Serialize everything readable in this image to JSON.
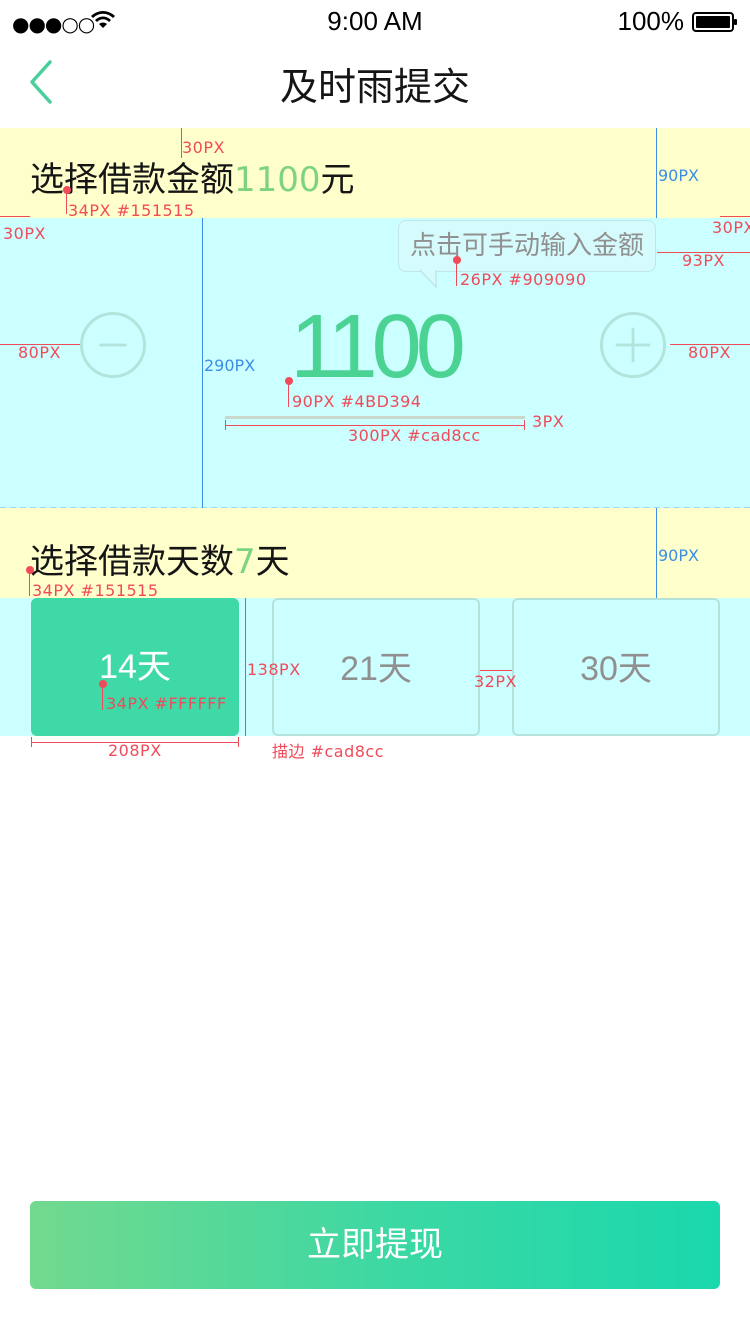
{
  "status_bar": {
    "signal": "●●●○○",
    "time": "9:00 AM",
    "battery": "100%"
  },
  "nav": {
    "title": "及时雨提交"
  },
  "amount_section": {
    "label_prefix": "选择借款金额",
    "label_amount": "1100",
    "label_suffix": "元",
    "value": "1100",
    "tooltip": "点击可手动输入金额"
  },
  "days_section": {
    "label_prefix": "选择借款天数",
    "label_days": "7",
    "label_suffix": "天",
    "options": [
      "14天",
      "21天",
      "30天"
    ],
    "selected_index": 0
  },
  "submit_label": "立即提现",
  "annotations": {
    "a30px_top": "30PX",
    "a90px_1": "90PX",
    "a34_151515_1": "34PX #151515",
    "a30px_left": "30PX",
    "a30px_right": "30PX",
    "a26_909090": "26PX #909090",
    "a93px": "93PX",
    "a80px_left": "80PX",
    "a290px": "290PX",
    "a80px_right": "80PX",
    "a90_4bd394": "90PX #4BD394",
    "a3px": "3PX",
    "a300_cad8cc": "300PX  #cad8cc",
    "a90px_2": "90PX",
    "a34_151515_2": "34PX #151515",
    "a138px": "138PX",
    "a34_ffffff": "34PX #FFFFFF",
    "a32px": "32PX",
    "a208px": "208PX",
    "a_stroke": "描边 #cad8cc"
  },
  "colors": {
    "accent": "#4bd394",
    "text": "#151515",
    "hint": "#909090",
    "line": "#cad8cc",
    "active_day": "#3fd9a7"
  }
}
